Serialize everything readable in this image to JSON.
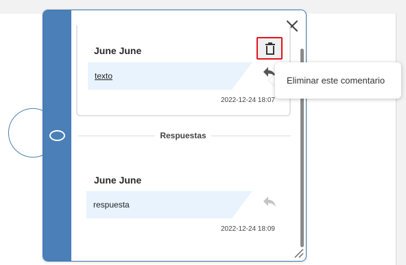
{
  "comment": {
    "author": "June June",
    "text": "texto",
    "timestamp": "2022-12-24 18:07",
    "delete_icon": "trash-icon",
    "reply_icon": "reply-icon"
  },
  "replies_section": {
    "label": "Respuestas"
  },
  "reply": {
    "author": "June June",
    "text": "respuesta",
    "timestamp": "2022-12-24 18:09",
    "reply_icon": "reply-icon"
  },
  "tooltip": {
    "text": "Eliminar este comentario"
  },
  "colors": {
    "side_bar": "#4a7fb8",
    "bubble": "#e8f3fd",
    "delete_highlight": "#e0131b"
  }
}
